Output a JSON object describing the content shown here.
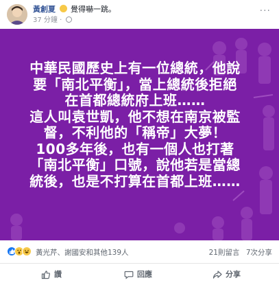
{
  "post": {
    "author": "黃創夏",
    "feeling": "覺得嚇一跳。",
    "feeling_emoji": "surprised-emoji-icon",
    "time": "37 分鐘",
    "dot": "·",
    "privacy_icon": "globe-icon",
    "more_label": "···"
  },
  "poster": {
    "background": "#7b1fa6",
    "lines": [
      "中華民國歷史上有一位總統，他說",
      "要「南北平衡」，當上總統後拒絕",
      "在首都總統府上班……",
      "這人叫袁世凱，他不想在南京被監",
      "督，不利他的「稱帝」大夢！",
      "100多年後，也有一個人也打著",
      "「南北平衡」口號，說他若是當總",
      "統後，也是不打算在首都上班……"
    ]
  },
  "stats": {
    "reaction_icons": [
      "like-icon",
      "wow-icon",
      "haha-icon"
    ],
    "names": "黃光芹、謝國安和其他139人",
    "comments": "21則留言",
    "shares": "7次分享"
  },
  "actions": {
    "like": "讚",
    "comment": "回應",
    "share": "分享"
  },
  "colors": {
    "author_link": "#385898",
    "poster_purple": "#7b1fa6",
    "like_blue": "#1877f2",
    "wow_yellow": "#f7c948"
  }
}
